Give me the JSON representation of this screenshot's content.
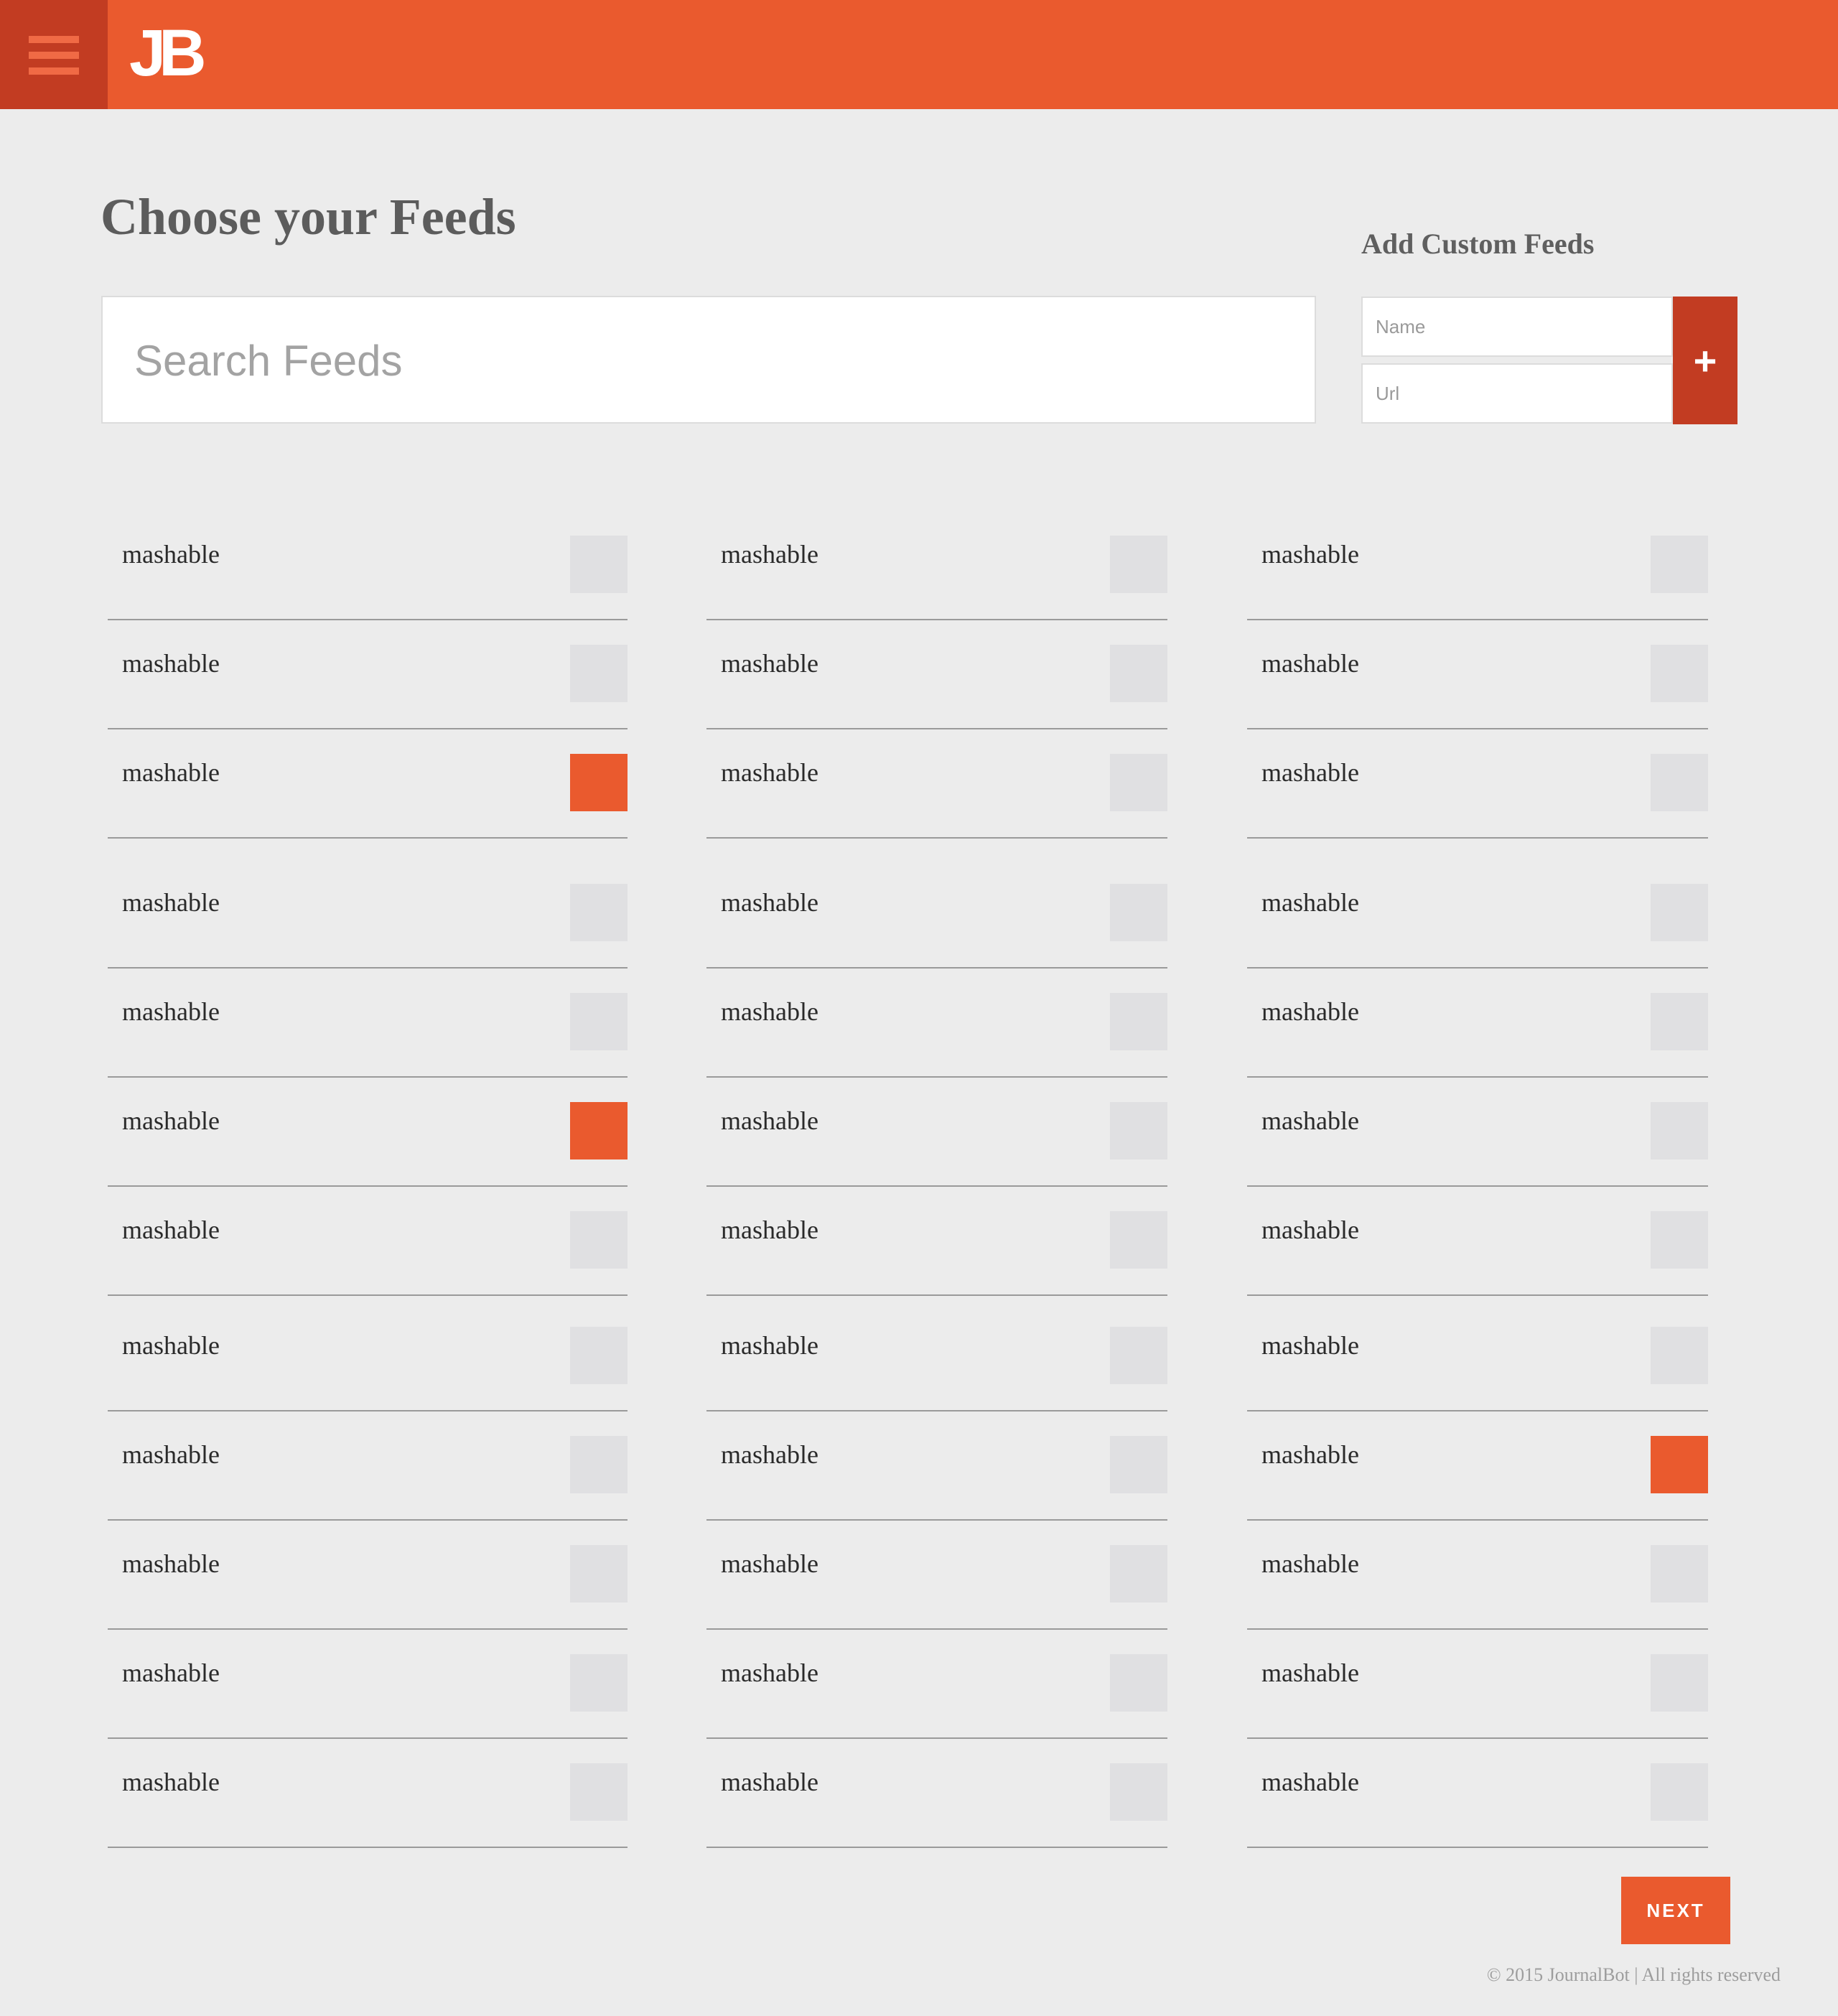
{
  "header": {
    "menu_icon": "hamburger-menu-icon",
    "logo_text": "JB",
    "brand_color": "#ea5a2e",
    "dark_accent": "#c23c22"
  },
  "main": {
    "title": "Choose your Feeds",
    "search": {
      "placeholder": "Search Feeds",
      "value": ""
    }
  },
  "custom_feeds": {
    "title": "Add Custom Feeds",
    "name_placeholder": "Name",
    "url_placeholder": "Url",
    "add_icon": "plus-icon",
    "add_label": "+"
  },
  "feeds": {
    "columns": [
      [
        {
          "label": "mashable",
          "checked": false
        },
        {
          "label": "mashable",
          "checked": false
        },
        {
          "label": "mashable",
          "checked": true
        },
        {
          "label": "mashable",
          "checked": false
        },
        {
          "label": "mashable",
          "checked": false
        },
        {
          "label": "mashable",
          "checked": true
        },
        {
          "label": "mashable",
          "checked": false
        },
        {
          "label": "mashable",
          "checked": false
        },
        {
          "label": "mashable",
          "checked": false
        },
        {
          "label": "mashable",
          "checked": false
        },
        {
          "label": "mashable",
          "checked": false
        },
        {
          "label": "mashable",
          "checked": false
        }
      ],
      [
        {
          "label": "mashable",
          "checked": false
        },
        {
          "label": "mashable",
          "checked": false
        },
        {
          "label": "mashable",
          "checked": false
        },
        {
          "label": "mashable",
          "checked": false
        },
        {
          "label": "mashable",
          "checked": false
        },
        {
          "label": "mashable",
          "checked": false
        },
        {
          "label": "mashable",
          "checked": false
        },
        {
          "label": "mashable",
          "checked": false
        },
        {
          "label": "mashable",
          "checked": false
        },
        {
          "label": "mashable",
          "checked": false
        },
        {
          "label": "mashable",
          "checked": false
        },
        {
          "label": "mashable",
          "checked": false
        }
      ],
      [
        {
          "label": "mashable",
          "checked": false
        },
        {
          "label": "mashable",
          "checked": false
        },
        {
          "label": "mashable",
          "checked": false
        },
        {
          "label": "mashable",
          "checked": false
        },
        {
          "label": "mashable",
          "checked": false
        },
        {
          "label": "mashable",
          "checked": false
        },
        {
          "label": "mashable",
          "checked": false
        },
        {
          "label": "mashable",
          "checked": false
        },
        {
          "label": "mashable",
          "checked": true
        },
        {
          "label": "mashable",
          "checked": false
        },
        {
          "label": "mashable",
          "checked": false
        },
        {
          "label": "mashable",
          "checked": false
        }
      ]
    ]
  },
  "actions": {
    "next_label": "NEXT"
  },
  "footer": {
    "text": "© 2015 JournalBot | All rights reserved"
  }
}
